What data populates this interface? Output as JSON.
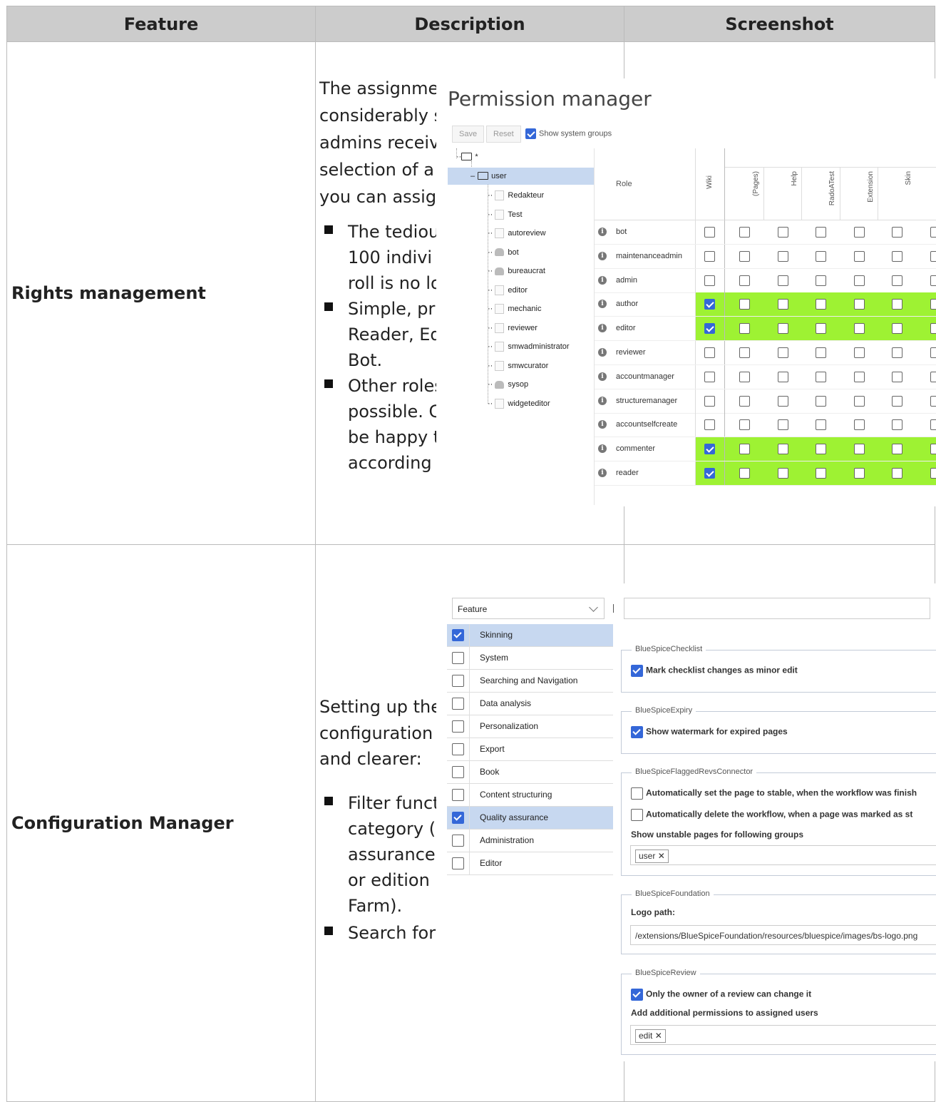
{
  "table": {
    "headers": [
      "Feature",
      "Description",
      "Screenshot"
    ],
    "rows": [
      {
        "feature": "Rights management",
        "desc_para": [
          "The assignme",
          "considerably s",
          "admins receiv",
          "selection of a",
          "you can assig"
        ],
        "bullets": [
          [
            "The tediou",
            "100 indivi",
            "roll is no lo"
          ],
          [
            "Simple, pr",
            "Reader, Ed",
            "Bot."
          ],
          [
            "Other roles",
            "possible. C",
            "be happy t",
            "according"
          ]
        ]
      },
      {
        "feature": "Configuration Manager",
        "desc_para": [
          "Setting up the",
          "configuration",
          "and clearer:"
        ],
        "bullets": [
          [
            "Filter funct",
            "category (",
            "assurance",
            "or edition",
            "Farm)."
          ],
          [
            "Search for"
          ]
        ]
      }
    ]
  },
  "permission_manager": {
    "title": "Permission manager",
    "save_label": "Save",
    "reset_label": "Reset",
    "show_system_groups_label": "Show system groups",
    "show_system_groups_checked": true,
    "tree": {
      "root": "*",
      "user": "user",
      "children": [
        {
          "label": "Redakteur",
          "icon": "page"
        },
        {
          "label": "Test",
          "icon": "page"
        },
        {
          "label": "autoreview",
          "icon": "page"
        },
        {
          "label": "bot",
          "icon": "group"
        },
        {
          "label": "bureaucrat",
          "icon": "group"
        },
        {
          "label": "editor",
          "icon": "page"
        },
        {
          "label": "mechanic",
          "icon": "page"
        },
        {
          "label": "reviewer",
          "icon": "page"
        },
        {
          "label": "smwadministrator",
          "icon": "page"
        },
        {
          "label": "smwcurator",
          "icon": "page"
        },
        {
          "label": "sysop",
          "icon": "group"
        },
        {
          "label": "widgeteditor",
          "icon": "page"
        }
      ]
    },
    "grid": {
      "role_header": "Role",
      "wiki_header": "Wiki",
      "columns": [
        "(Pages)",
        "Help",
        "RadoATest",
        "Extension",
        "Skin"
      ],
      "roles": [
        {
          "name": "bot",
          "wiki": false
        },
        {
          "name": "maintenanceadmin",
          "wiki": false
        },
        {
          "name": "admin",
          "wiki": false
        },
        {
          "name": "author",
          "wiki": true
        },
        {
          "name": "editor",
          "wiki": true
        },
        {
          "name": "reviewer",
          "wiki": false
        },
        {
          "name": "accountmanager",
          "wiki": false
        },
        {
          "name": "structuremanager",
          "wiki": false
        },
        {
          "name": "accountselfcreate",
          "wiki": false
        },
        {
          "name": "commenter",
          "wiki": true
        },
        {
          "name": "reader",
          "wiki": true
        }
      ],
      "highlight_color": "#9ef233"
    }
  },
  "config_manager": {
    "filter_select": "Feature",
    "categories": [
      {
        "label": "Skinning",
        "checked": true
      },
      {
        "label": "System",
        "checked": false
      },
      {
        "label": "Searching and Navigation",
        "checked": false
      },
      {
        "label": "Data analysis",
        "checked": false
      },
      {
        "label": "Personalization",
        "checked": false
      },
      {
        "label": "Export",
        "checked": false
      },
      {
        "label": "Book",
        "checked": false
      },
      {
        "label": "Content structuring",
        "checked": false
      },
      {
        "label": "Quality assurance",
        "checked": true
      },
      {
        "label": "Administration",
        "checked": false
      },
      {
        "label": "Editor",
        "checked": false
      }
    ],
    "sections": {
      "checklist": {
        "legend": "BlueSpiceChecklist",
        "option": "Mark checklist changes as minor edit"
      },
      "expiry": {
        "legend": "BlueSpiceExpiry",
        "option": "Show watermark for expired pages"
      },
      "flagged": {
        "legend": "BlueSpiceFlaggedRevsConnector",
        "option1": "Automatically set the page to stable, when the workflow was finish",
        "option2": "Automatically delete the workflow, when a page was marked as st",
        "groups_label": "Show unstable pages for following groups",
        "groups_tag": "user"
      },
      "foundation": {
        "legend": "BlueSpiceFoundation",
        "logo_label": "Logo path:",
        "logo_value": "/extensions/BlueSpiceFoundation/resources/bluespice/images/bs-logo.png"
      },
      "review": {
        "legend": "BlueSpiceReview",
        "option": "Only the owner of a review can change it",
        "perm_label": "Add additional permissions to assigned users",
        "perm_tag": "edit"
      }
    }
  },
  "colors": {
    "header_bg": "#cccccc",
    "accent": "#3467d8",
    "selected_row": "#c7d8f0"
  }
}
